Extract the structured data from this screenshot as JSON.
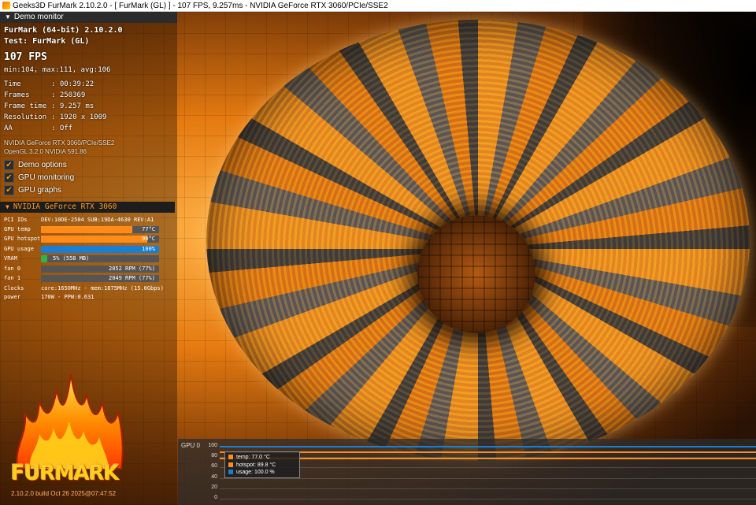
{
  "window": {
    "title": "Geeks3D FurMark 2.10.2.0 - [ FurMark (GL) ] - 107 FPS, 9.257ms - NVIDIA GeForce RTX 3060/PCIe/SSE2"
  },
  "demo_monitor": {
    "header": "Demo monitor",
    "app_line": "FurMark (64-bit) 2.10.2.0",
    "test_line": "Test: FurMark (GL)",
    "fps": "107 FPS",
    "fps_stats": "min:104, max:111, avg:106",
    "stats": [
      {
        "label": "Time",
        "value": ": 00:39:22"
      },
      {
        "label": "Frames",
        "value": ": 250369"
      },
      {
        "label": "Frame time",
        "value": ": 9.257 ms"
      },
      {
        "label": "Resolution",
        "value": ": 1920 x 1009"
      },
      {
        "label": "AA",
        "value": ": Off"
      }
    ],
    "renderer": "NVIDIA GeForce RTX 3060/PCIe/SSE2",
    "opengl": "OpenGL 3.2.0 NVIDIA 591.86",
    "options": [
      {
        "label": "Demo options",
        "checked": true
      },
      {
        "label": "GPU monitoring",
        "checked": true
      },
      {
        "label": "GPU graphs",
        "checked": true
      }
    ]
  },
  "gpu_panel": {
    "header": "NVIDIA GeForce RTX 3060",
    "pci_label": "PCI IDs",
    "pci_value": "DEV:10DE-2504 SUB:19DA-4630 REV:A1",
    "metrics": [
      {
        "label": "GPU temp",
        "text": "77°C",
        "fraction": 0.77,
        "color": "#ff8c1a"
      },
      {
        "label": "GPU hotspot",
        "text": "90°C",
        "fraction": 0.9,
        "color": "#ff8c1a"
      },
      {
        "label": "GPU usage",
        "text": "100%",
        "fraction": 1.0,
        "color": "#1a7fd4"
      },
      {
        "label": "VRAM",
        "text": "5% (558 MB)",
        "fraction": 0.05,
        "color": "#2fb34a"
      },
      {
        "label": "fan 0",
        "text": "2052 RPM (77%)",
        "fraction": 0.0,
        "color": "#777777"
      },
      {
        "label": "fan 1",
        "text": "2049 RPM (77%)",
        "fraction": 0.0,
        "color": "#777777"
      }
    ],
    "clocks_label": "Clocks",
    "clocks_value": "core:1650MHz - mem:1875MHz (15.0Gbps)",
    "power_label": "power",
    "power_value": "170W - PPW:0.631"
  },
  "logo": {
    "word": "FURMARK",
    "build": "2.10.2.0 build Oct 26 2025@07:47:52"
  },
  "chart_data": {
    "type": "line",
    "title": "GPU 0",
    "ylim": [
      0,
      100
    ],
    "yticks": [
      "100",
      "80",
      "60",
      "40",
      "20",
      "0"
    ],
    "grid": true,
    "legend_placement": "top-left",
    "series": [
      {
        "name": "temp: 77.0 °C",
        "values": [
          77,
          77
        ],
        "color": "#ff8c1a"
      },
      {
        "name": "hotspot: 89.8 °C",
        "values": [
          89.8,
          89.8
        ],
        "color": "#ff8c1a"
      },
      {
        "name": "usage: 100.0 %",
        "values": [
          100,
          100
        ],
        "color": "#1a7fd4"
      }
    ]
  }
}
